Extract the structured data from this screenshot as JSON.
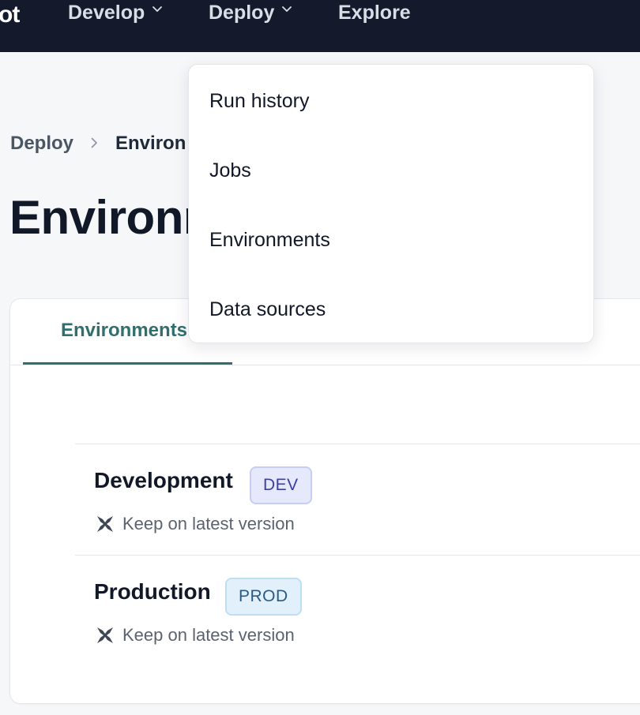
{
  "topnav": {
    "logo_fragment": "ot",
    "items": [
      {
        "label": "Develop",
        "has_dropdown": true
      },
      {
        "label": "Deploy",
        "has_dropdown": true
      },
      {
        "label": "Explore",
        "has_dropdown": false
      }
    ]
  },
  "breadcrumb": {
    "parent": "Deploy",
    "current": "Environ"
  },
  "page": {
    "title": "Environm"
  },
  "deploy_menu": {
    "items": [
      "Run history",
      "Jobs",
      "Environments",
      "Data sources"
    ]
  },
  "tabs": {
    "active_label": "Environments"
  },
  "environments": [
    {
      "name": "Development",
      "badge": "DEV",
      "version": "Keep on latest version"
    },
    {
      "name": "Production",
      "badge": "PROD",
      "version": "Keep on latest version"
    }
  ],
  "colors": {
    "topbar_bg": "#141a2b",
    "accent": "#2f6f6f",
    "dev_badge_bg": "#e6e9fb",
    "prod_badge_bg": "#e1f0fb"
  },
  "icons": {
    "nav_dropdown": "chevron-down-icon",
    "breadcrumb_separator": "chevron-right-icon",
    "version": "dbt-logo-icon"
  }
}
